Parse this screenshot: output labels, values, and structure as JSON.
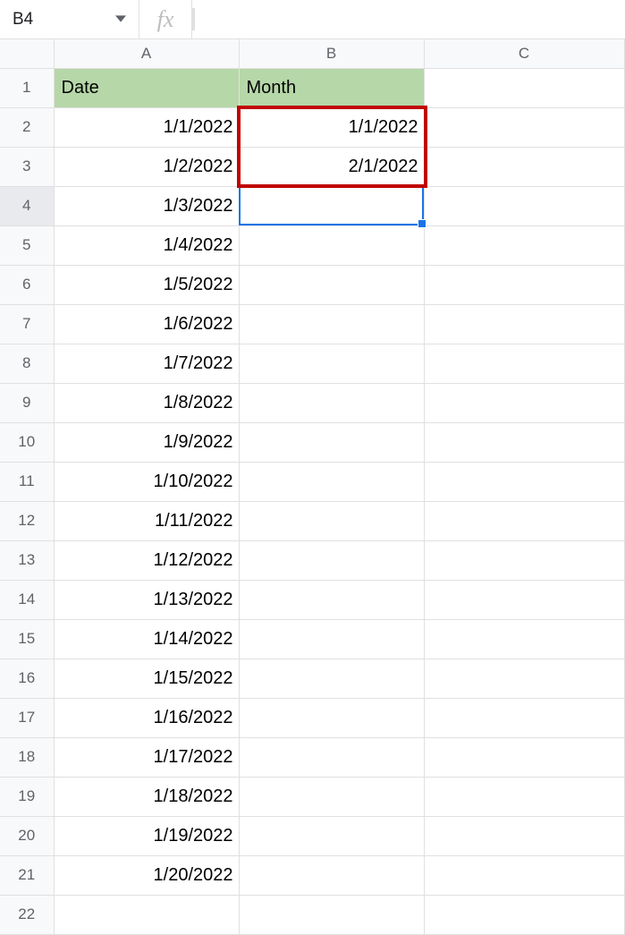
{
  "formula_bar": {
    "cell_ref": "B4",
    "fx_label": "fx",
    "formula_value": ""
  },
  "columns": [
    "A",
    "B",
    "C"
  ],
  "rows": [
    "1",
    "2",
    "3",
    "4",
    "5",
    "6",
    "7",
    "8",
    "9",
    "10",
    "11",
    "12",
    "13",
    "14",
    "15",
    "16",
    "17",
    "18",
    "19",
    "20",
    "21",
    "22"
  ],
  "headers": {
    "A": "Date",
    "B": "Month"
  },
  "data_A": {
    "2": "1/1/2022",
    "3": "1/2/2022",
    "4": "1/3/2022",
    "5": "1/4/2022",
    "6": "1/5/2022",
    "7": "1/6/2022",
    "8": "1/7/2022",
    "9": "1/8/2022",
    "10": "1/9/2022",
    "11": "1/10/2022",
    "12": "1/11/2022",
    "13": "1/12/2022",
    "14": "1/13/2022",
    "15": "1/14/2022",
    "16": "1/15/2022",
    "17": "1/16/2022",
    "18": "1/17/2022",
    "19": "1/18/2022",
    "20": "1/19/2022",
    "21": "1/20/2022"
  },
  "data_B": {
    "2": "1/1/2022",
    "3": "2/1/2022"
  },
  "active_cell": "B4",
  "highlight_range": "B2:B3"
}
